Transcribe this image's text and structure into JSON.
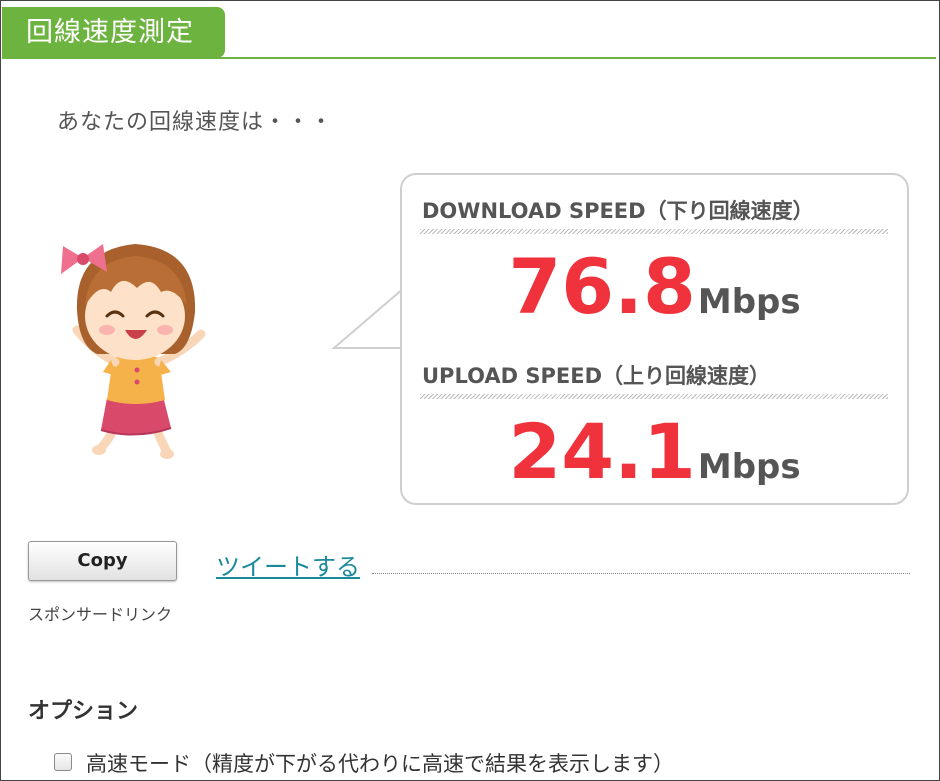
{
  "header": {
    "title": "回線速度測定"
  },
  "intro_text": "あなたの回線速度は・・・",
  "results": {
    "download_label": "DOWNLOAD SPEED（下り回線速度）",
    "download_value": "76.8",
    "upload_label": "UPLOAD SPEED（上り回線速度）",
    "upload_value": "24.1",
    "unit": "Mbps"
  },
  "actions": {
    "copy_label": "Copy",
    "tweet_label": "ツイートする"
  },
  "sponsored_text": "スポンサードリンク",
  "options": {
    "heading": "オプション",
    "items": [
      {
        "label": "高速モード（精度が下がる代わりに高速で結果を表示します）",
        "checked": false
      }
    ]
  },
  "colors": {
    "header_green": "#6db33f",
    "speed_red": "#f0323c",
    "link_teal": "#1a8a9a"
  },
  "icons": {
    "mascot": "cheering-girl-illustration"
  }
}
